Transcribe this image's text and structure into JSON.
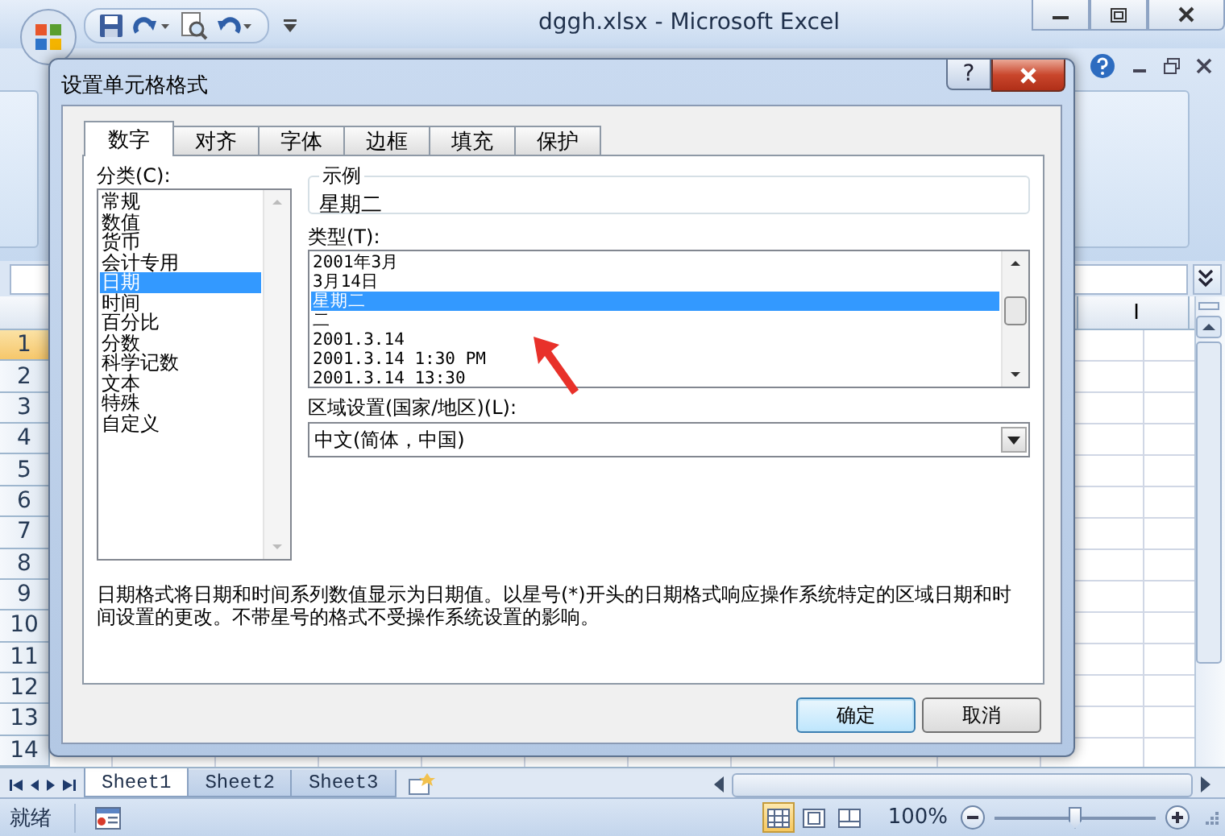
{
  "window": {
    "title": "dggh.xlsx - Microsoft Excel"
  },
  "sheet": {
    "column_headers": [
      "I"
    ],
    "row_headers": [
      {
        "label": "1",
        "selected": true
      },
      {
        "label": "2",
        "selected": false
      },
      {
        "label": "3",
        "selected": false
      },
      {
        "label": "4",
        "selected": false
      },
      {
        "label": "5",
        "selected": false
      },
      {
        "label": "6",
        "selected": false
      },
      {
        "label": "7",
        "selected": false
      },
      {
        "label": "8",
        "selected": false
      },
      {
        "label": "9",
        "selected": false
      },
      {
        "label": "10",
        "selected": false
      },
      {
        "label": "11",
        "selected": false
      },
      {
        "label": "12",
        "selected": false
      },
      {
        "label": "13",
        "selected": false
      },
      {
        "label": "14",
        "selected": false
      }
    ]
  },
  "dialog": {
    "title": "设置单元格格式",
    "help_button": "?",
    "tabs": [
      {
        "label": "数字",
        "selected": true
      },
      {
        "label": "对齐",
        "selected": false
      },
      {
        "label": "字体",
        "selected": false
      },
      {
        "label": "边框",
        "selected": false
      },
      {
        "label": "填充",
        "selected": false
      },
      {
        "label": "保护",
        "selected": false
      }
    ],
    "category_label": "分类(C):",
    "categories": [
      {
        "label": "常规",
        "selected": false
      },
      {
        "label": "数值",
        "selected": false
      },
      {
        "label": "货币",
        "selected": false
      },
      {
        "label": "会计专用",
        "selected": false
      },
      {
        "label": "日期",
        "selected": true
      },
      {
        "label": "时间",
        "selected": false
      },
      {
        "label": "百分比",
        "selected": false
      },
      {
        "label": "分数",
        "selected": false
      },
      {
        "label": "科学记数",
        "selected": false
      },
      {
        "label": "文本",
        "selected": false
      },
      {
        "label": "特殊",
        "selected": false
      },
      {
        "label": "自定义",
        "selected": false
      }
    ],
    "sample": {
      "label": "示例",
      "value": "星期二"
    },
    "type_label": "类型(T):",
    "types": [
      {
        "label": "2001年3月",
        "selected": false
      },
      {
        "label": "3月14日",
        "selected": false
      },
      {
        "label": "星期二",
        "selected": true
      },
      {
        "label": "二",
        "selected": false
      },
      {
        "label": "2001.3.14",
        "selected": false
      },
      {
        "label": "2001.3.14 1:30 PM",
        "selected": false
      },
      {
        "label": "2001.3.14 13:30",
        "selected": false
      }
    ],
    "locale_label": "区域设置(国家/地区)(L):",
    "locale": {
      "value": "中文(简体，中国)"
    },
    "description": "日期格式将日期和时间系列数值显示为日期值。以星号(*)开头的日期格式响应操作系统特定的区域日期和时间设置的更改。不带星号的格式不受操作系统设置的影响。",
    "buttons": [
      {
        "label": "确定",
        "kind": "default"
      },
      {
        "label": "取消",
        "kind": "normal"
      }
    ]
  },
  "sheet_tabs": [
    {
      "label": "Sheet1",
      "selected": true
    },
    {
      "label": "Sheet2",
      "selected": false
    },
    {
      "label": "Sheet3",
      "selected": false
    }
  ],
  "status_bar": {
    "text": "就绪",
    "views": [
      {
        "kind": "normal",
        "selected": true
      },
      {
        "kind": "page_layout",
        "selected": false
      },
      {
        "kind": "page_break",
        "selected": false
      }
    ],
    "zoom": "100%",
    "zoom_slider": {
      "level": 0.5
    }
  }
}
